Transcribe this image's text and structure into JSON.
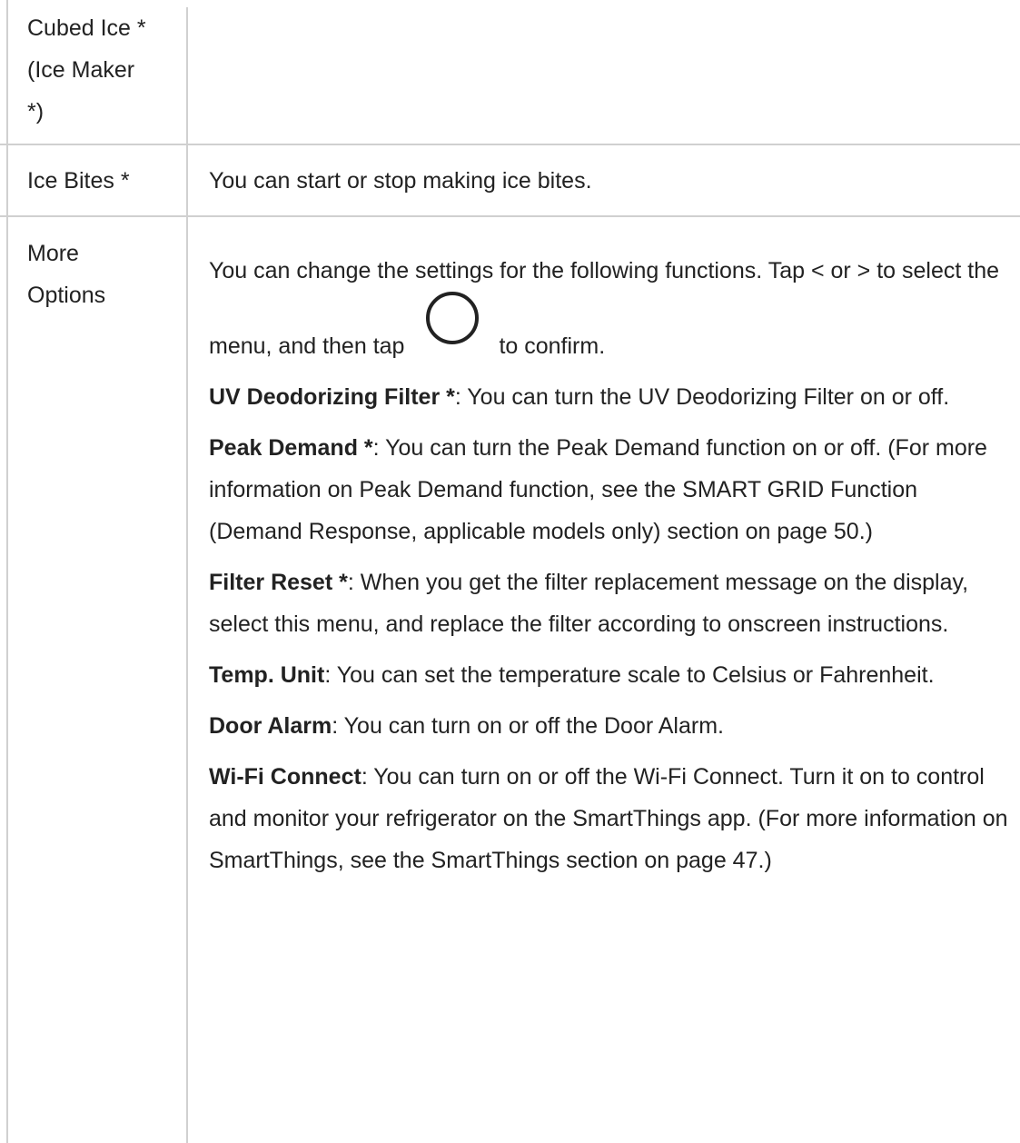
{
  "rows": [
    {
      "label_lines": [
        "Cubed Ice *",
        "(Ice Maker",
        "*)"
      ],
      "description": ""
    },
    {
      "label_lines": [
        "Ice Bites *"
      ],
      "description": "You can start or stop making ice bites."
    },
    {
      "label_lines": [
        "More",
        "Options"
      ],
      "intro_before": "You can change the settings for the following functions. Tap < or > to select the menu, and then tap",
      "intro_icon": "circle-icon",
      "intro_after": "to confirm.",
      "items": [
        {
          "term": "UV Deodorizing Filter *",
          "text": ": You can turn the UV Deodorizing Filter on or off."
        },
        {
          "term": "Peak Demand *",
          "text": ": You can turn the Peak Demand function on or off. (For more information on Peak Demand function, see the SMART GRID Function (Demand Response, applicable models only) section on page 50.)"
        },
        {
          "term": "Filter Reset *",
          "text": ": When you get the filter replacement message on the display, select this menu, and replace the filter according to onscreen instructions."
        },
        {
          "term": "Temp. Unit",
          "text": ": You can set the temperature scale to Celsius or Fahrenheit."
        },
        {
          "term": "Door Alarm",
          "text": ": You can turn on or off the Door Alarm."
        },
        {
          "term": "Wi-Fi Connect",
          "text": ": You can turn on or off the Wi-Fi Connect. Turn it on to control and monitor your refrigerator on the SmartThings app. (For more information on SmartThings, see the SmartThings section on page 47.)"
        }
      ]
    }
  ]
}
